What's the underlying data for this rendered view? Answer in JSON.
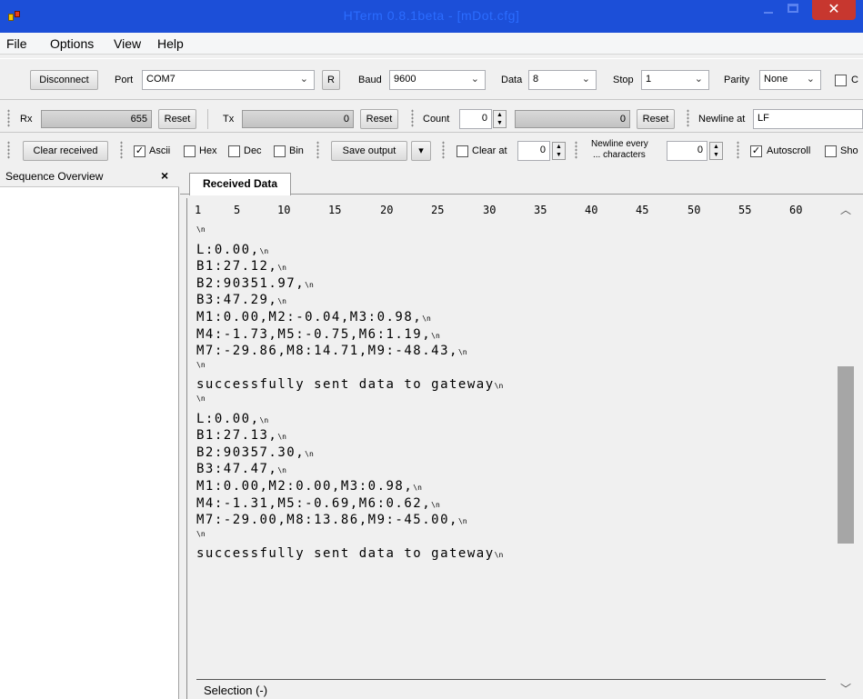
{
  "window": {
    "title": "HTerm 0.8.1beta - [mDot.cfg]",
    "close_label": "✕"
  },
  "menu": [
    "File",
    "Options",
    "View",
    "Help"
  ],
  "toolbar1": {
    "disconnect": "Disconnect",
    "port_label": "Port",
    "port_value": "COM7",
    "r_button": "R",
    "baud_label": "Baud",
    "baud_value": "9600",
    "data_label": "Data",
    "data_value": "8",
    "stop_label": "Stop",
    "stop_value": "1",
    "parity_label": "Parity",
    "parity_value": "None",
    "cts_partial": "C"
  },
  "toolbar2": {
    "rx_label": "Rx",
    "rx_value": "655",
    "rx_reset": "Reset",
    "tx_label": "Tx",
    "tx_value": "0",
    "tx_reset": "Reset",
    "count_label": "Count",
    "count_value": "0",
    "count_bar_value": "0",
    "count_reset": "Reset",
    "newline_label": "Newline at",
    "newline_value": "LF"
  },
  "toolbar3": {
    "clear_received": "Clear received",
    "ascii": "Ascii",
    "hex": "Hex",
    "dec": "Dec",
    "bin": "Bin",
    "save_output": "Save output",
    "clear_at": "Clear at",
    "clear_at_value": "0",
    "newline_every_1": "Newline every",
    "newline_every_2": "... characters",
    "newline_every_value": "0",
    "autoscroll": "Autoscroll",
    "show_partial": "Sho"
  },
  "sequence": {
    "title": "Sequence Overview",
    "close": "×"
  },
  "received": {
    "tab": "Received Data",
    "ruler": [
      "1",
      "5",
      "10",
      "15",
      "20",
      "25",
      "30",
      "35",
      "40",
      "45",
      "50",
      "55",
      "60"
    ],
    "lines": [
      "\\n",
      "L:0.00,",
      "B1:27.12,",
      "B2:90351.97,",
      "B3:47.29,",
      "M1:0.00,M2:-0.04,M3:0.98,",
      "M4:-1.73,M5:-0.75,M6:1.19,",
      "M7:-29.86,M8:14.71,M9:-48.43,",
      "\\n",
      "successfully sent data to gateway",
      "\\n",
      "L:0.00,",
      "B1:27.13,",
      "B2:90357.30,",
      "B3:47.47,",
      "M1:0.00,M2:0.00,M3:0.98,",
      "M4:-1.31,M5:-0.69,M6:0.62,",
      "M7:-29.00,M8:13.86,M9:-45.00,",
      "\\n",
      "successfully sent data to gateway"
    ],
    "nl_mark": "\\n",
    "selection": "Selection (-)"
  }
}
